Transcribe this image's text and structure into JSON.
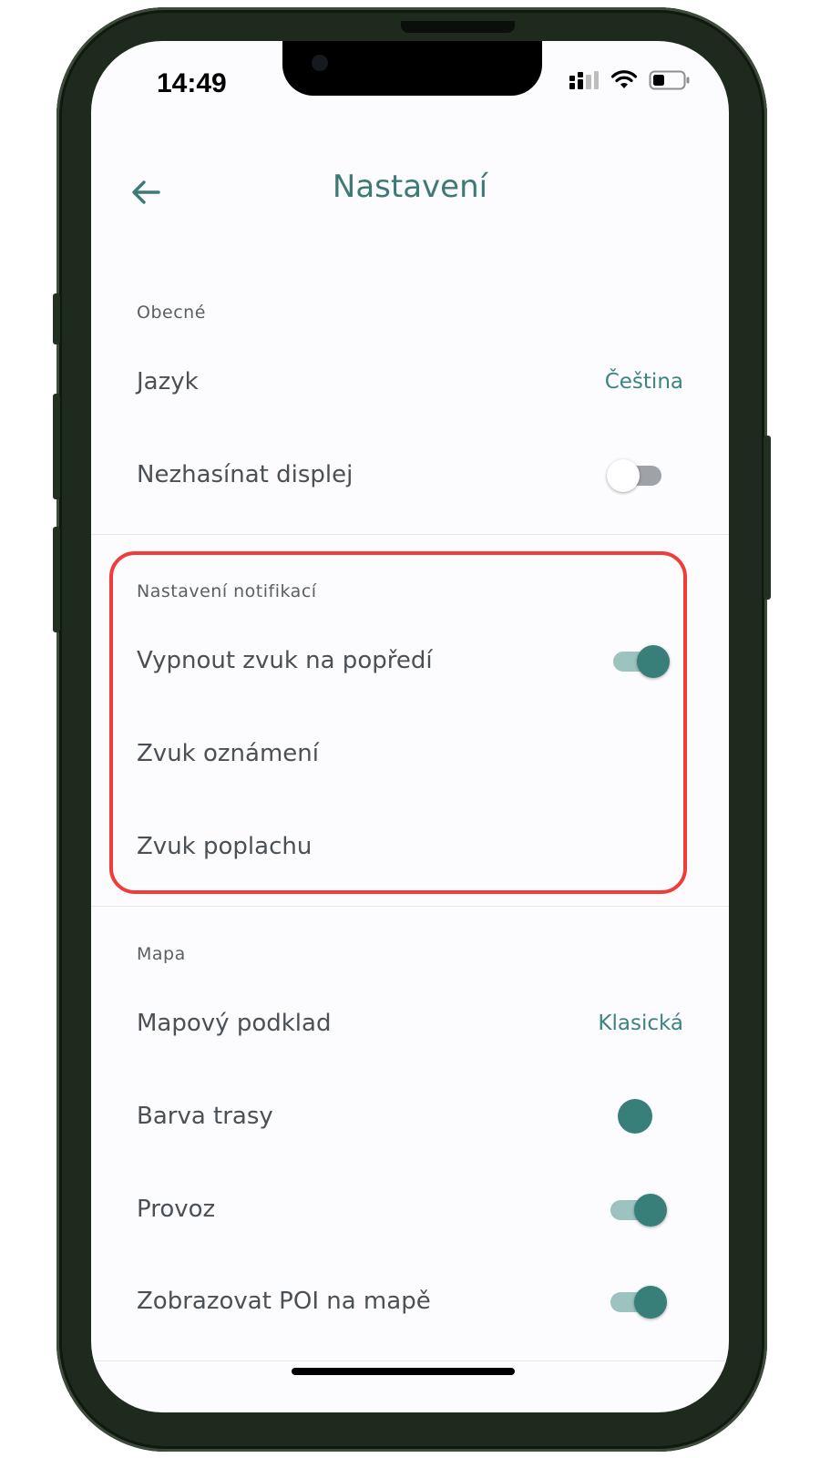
{
  "status_bar": {
    "time": "14:49",
    "icons": [
      "cellular-signal-icon",
      "wifi-icon",
      "battery-icon"
    ]
  },
  "header": {
    "back_icon": "arrow-left-icon",
    "title": "Nastavení"
  },
  "sections": {
    "general": {
      "header": "Obecné",
      "language": {
        "label": "Jazyk",
        "value": "Čeština"
      },
      "keep_screen_on": {
        "label": "Nezhasínat displej",
        "enabled": false
      }
    },
    "notifications": {
      "header": "Nastavení notifikací",
      "mute_foreground": {
        "label": "Vypnout zvuk na popředí",
        "enabled": true
      },
      "notification_sound": {
        "label": "Zvuk oznámení"
      },
      "alarm_sound": {
        "label": "Zvuk poplachu"
      }
    },
    "map": {
      "header": "Mapa",
      "map_base": {
        "label": "Mapový podklad",
        "value": "Klasická"
      },
      "route_color": {
        "label": "Barva trasy",
        "color": "#387e79"
      },
      "traffic": {
        "label": "Provoz",
        "enabled": true
      },
      "show_poi": {
        "label": "Zobrazovat POI na mapě",
        "enabled": true
      }
    }
  },
  "colors": {
    "accent": "#3d7a76",
    "highlight_border": "#ef3d3a",
    "phone_frame": "#1f2a1f"
  }
}
